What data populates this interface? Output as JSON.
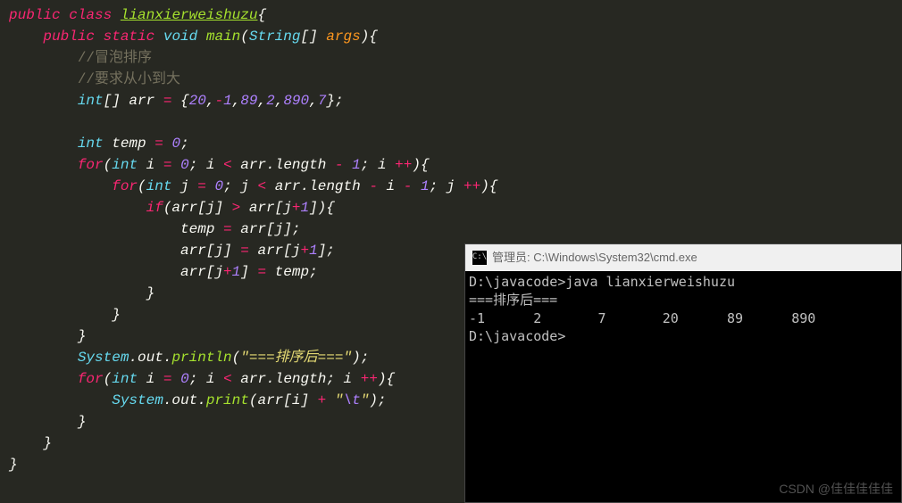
{
  "code": {
    "kw_public": "public",
    "kw_class": "class",
    "cls_name": "lianxierweishuzu",
    "kw_static": "static",
    "kw_void": "void",
    "fn_main": "main",
    "type_string": "String",
    "param_args": "args",
    "comment1": "//冒泡排序",
    "comment2": "//要求从小到大",
    "type_int": "int",
    "var_arr": "arr",
    "arr_init": "{",
    "arr_vals": [
      "20",
      "-",
      "1",
      "89",
      "2",
      "890",
      "7"
    ],
    "var_temp": "temp",
    "num_0": "0",
    "num_1": "1",
    "kw_for": "for",
    "var_i": "i",
    "var_j": "j",
    "field_length": "length",
    "kw_if": "if",
    "sys": "System",
    "field_out": "out",
    "fn_println": "println",
    "fn_print": "print",
    "str_sort": "\"===排序后===\"",
    "str_tab_open": "\"",
    "str_tab_esc": "\\t",
    "str_tab_close": "\""
  },
  "terminal": {
    "title": "管理员: C:\\Windows\\System32\\cmd.exe",
    "icon_text": "C:\\",
    "line1": "D:\\javacode>java lianxierweishuzu",
    "line2": "===排序后===",
    "line3": "-1      2       7       20      89      890",
    "line4": "D:\\javacode>"
  },
  "watermark": "CSDN @佳佳佳佳佳"
}
